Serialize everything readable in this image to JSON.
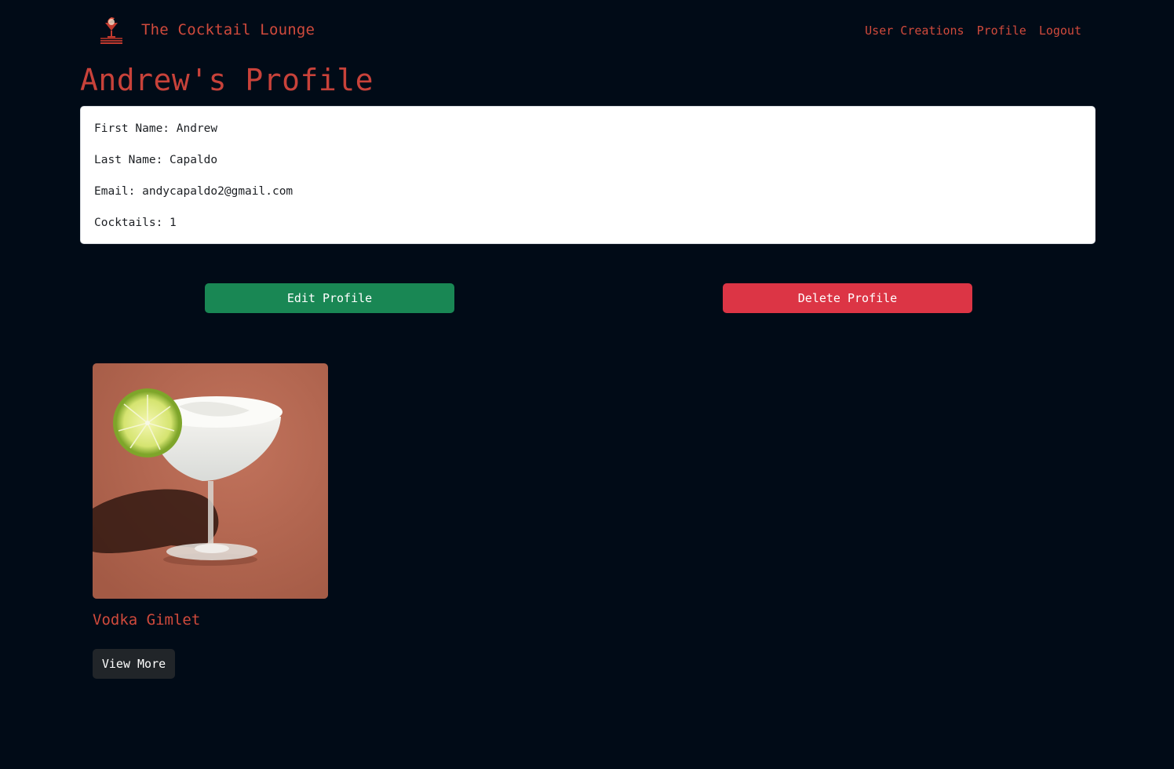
{
  "navbar": {
    "brand_logo_icon": "cocktail-logo-icon",
    "brand": "The Cocktail Lounge",
    "links": [
      {
        "label": "User Creations"
      },
      {
        "label": "Profile"
      },
      {
        "label": "Logout"
      }
    ]
  },
  "page": {
    "title": "Andrew's Profile"
  },
  "profile": {
    "first_name": "First Name: Andrew",
    "last_name": "Last Name: Capaldo",
    "email": "Email: andycapaldo2@gmail.com",
    "cocktails": "Cocktails: 1"
  },
  "actions": {
    "edit_label": "Edit Profile",
    "delete_label": "Delete Profile"
  },
  "cocktails": [
    {
      "name": "Vodka Gimlet",
      "button_label": "View More"
    }
  ],
  "colors": {
    "background": "#010b17",
    "accent": "#d04a3c",
    "edit": "#198754",
    "delete": "#dc3545",
    "view": "#212529"
  }
}
